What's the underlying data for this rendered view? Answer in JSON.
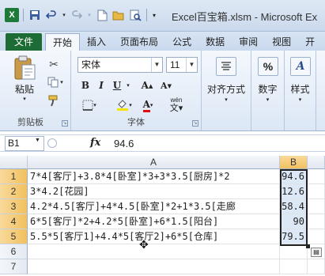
{
  "window": {
    "title": "Excel百宝箱.xlsm - Microsoft Ex",
    "qat_icons": [
      "excel-logo-icon",
      "save-icon",
      "undo-icon",
      "redo-icon",
      "open-folder-icon",
      "print-preview-icon",
      "customize-qat-icon"
    ]
  },
  "tabs": [
    "文件",
    "开始",
    "插入",
    "页面布局",
    "公式",
    "数据",
    "审阅",
    "视图",
    "开"
  ],
  "ribbon": {
    "clipboard": {
      "paste": "粘贴",
      "label": "剪贴板"
    },
    "font": {
      "name": "宋体",
      "size": "11",
      "bold": "B",
      "italic": "I",
      "underline": "U",
      "grow": "A",
      "shrink": "A",
      "font_color": "A",
      "phonetic": "wén",
      "label": "字体"
    },
    "alignment": {
      "label": "对齐方式"
    },
    "number": {
      "label": "数字"
    },
    "styles": {
      "label": "样式"
    }
  },
  "formula_bar": {
    "name_box": "B1",
    "fx": "fx",
    "value": "94.6"
  },
  "grid": {
    "columns": [
      "A",
      "B"
    ],
    "rows": [
      {
        "num": "1",
        "a": "7*4[客厅]+3.8*4[卧室]*3+3*3.5[厨房]*2",
        "b": "94.6"
      },
      {
        "num": "2",
        "a": "3*4.2[花园]",
        "b": "12.6"
      },
      {
        "num": "3",
        "a": "4.2*4.5[客厅]+4*4.5[卧室]*2+1*3.5[走廊",
        "b": "58.4"
      },
      {
        "num": "4",
        "a": "6*5[客厅]*2+4.2*5[卧室]+6*1.5[阳台]",
        "b": "90"
      },
      {
        "num": "5",
        "a": "5.5*5[客厅1]+4.4*5[客厅2]+6*5[仓库]",
        "b": "79.5"
      },
      {
        "num": "6",
        "a": "",
        "b": ""
      },
      {
        "num": "7",
        "a": "",
        "b": ""
      }
    ]
  },
  "colors": {
    "file_tab": "#1d6b35",
    "selection_header": "#f1c15f",
    "selected_cell_fill": "#dde8f6"
  }
}
